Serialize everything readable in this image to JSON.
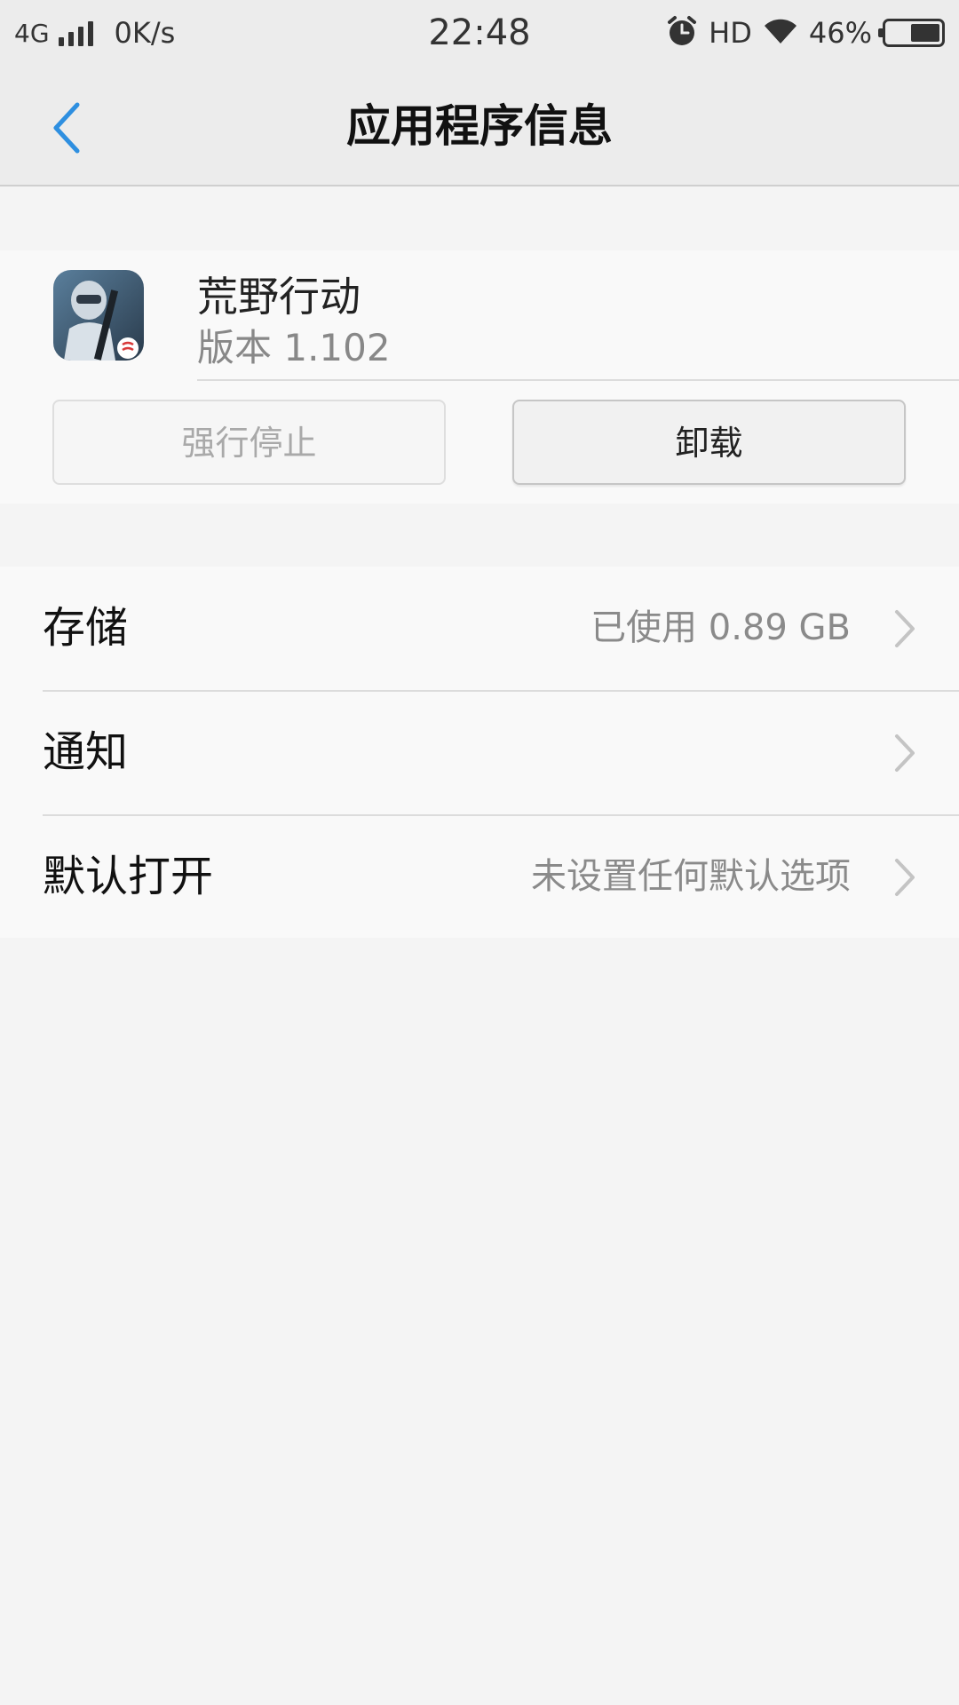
{
  "status_bar": {
    "network": "4G",
    "speed": "0K/s",
    "time": "22:48",
    "hd": "HD",
    "battery": "46%",
    "icons": [
      "signal-icon",
      "alarm-icon",
      "wifi-icon",
      "battery-icon"
    ]
  },
  "header": {
    "title": "应用程序信息",
    "back_icon": "chevron-left-icon",
    "back_color": "#2e8fe0"
  },
  "app": {
    "name": "荒野行动",
    "version": "版本 1.102",
    "icon": "game-character-icon"
  },
  "buttons": {
    "force_stop": "强行停止",
    "uninstall": "卸载"
  },
  "settings": {
    "items": [
      {
        "label": "存储",
        "value": "已使用 0.89 GB"
      },
      {
        "label": "通知",
        "value": ""
      },
      {
        "label": "默认打开",
        "value": "未设置任何默认选项"
      }
    ]
  }
}
